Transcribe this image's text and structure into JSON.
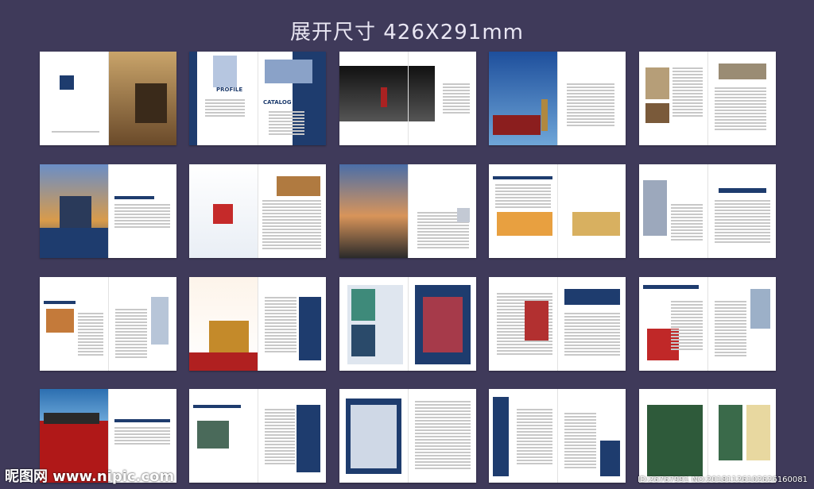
{
  "title": "展开尺寸 426X291mm",
  "watermark": {
    "site": "昵图网 www.nipic.com",
    "id": "ID:26767991 NO:20181126102626160081"
  },
  "spreads": [
    {
      "r": 0,
      "c": 0,
      "label": "cover-law"
    },
    {
      "r": 0,
      "c": 1,
      "label": "profile-catalog",
      "t1": "PROFILE",
      "t2": "CATALOG"
    },
    {
      "r": 0,
      "c": 2,
      "label": "chess"
    },
    {
      "r": 0,
      "c": 3,
      "label": "temple-crane"
    },
    {
      "r": 0,
      "c": 4,
      "label": "scales"
    },
    {
      "r": 1,
      "c": 0,
      "label": "temple-heaven"
    },
    {
      "r": 1,
      "c": 1,
      "label": "speech"
    },
    {
      "r": 1,
      "c": 2,
      "label": "mountain"
    },
    {
      "r": 1,
      "c": 3,
      "label": "finance"
    },
    {
      "r": 1,
      "c": 4,
      "label": "wealth"
    },
    {
      "r": 2,
      "c": 0,
      "label": "cards"
    },
    {
      "r": 2,
      "c": 1,
      "label": "horse-stamps"
    },
    {
      "r": 2,
      "c": 2,
      "label": "stamp-sheets"
    },
    {
      "r": 2,
      "c": 3,
      "label": "stamp-strip"
    },
    {
      "r": 2,
      "c": 4,
      "label": "question"
    },
    {
      "r": 3,
      "c": 0,
      "label": "culture-red"
    },
    {
      "r": 3,
      "c": 1,
      "label": "bronze"
    },
    {
      "r": 3,
      "c": 2,
      "label": "stamp-grid"
    },
    {
      "r": 3,
      "c": 3,
      "label": "stamp-blue"
    },
    {
      "r": 3,
      "c": 4,
      "label": "green-art"
    }
  ]
}
